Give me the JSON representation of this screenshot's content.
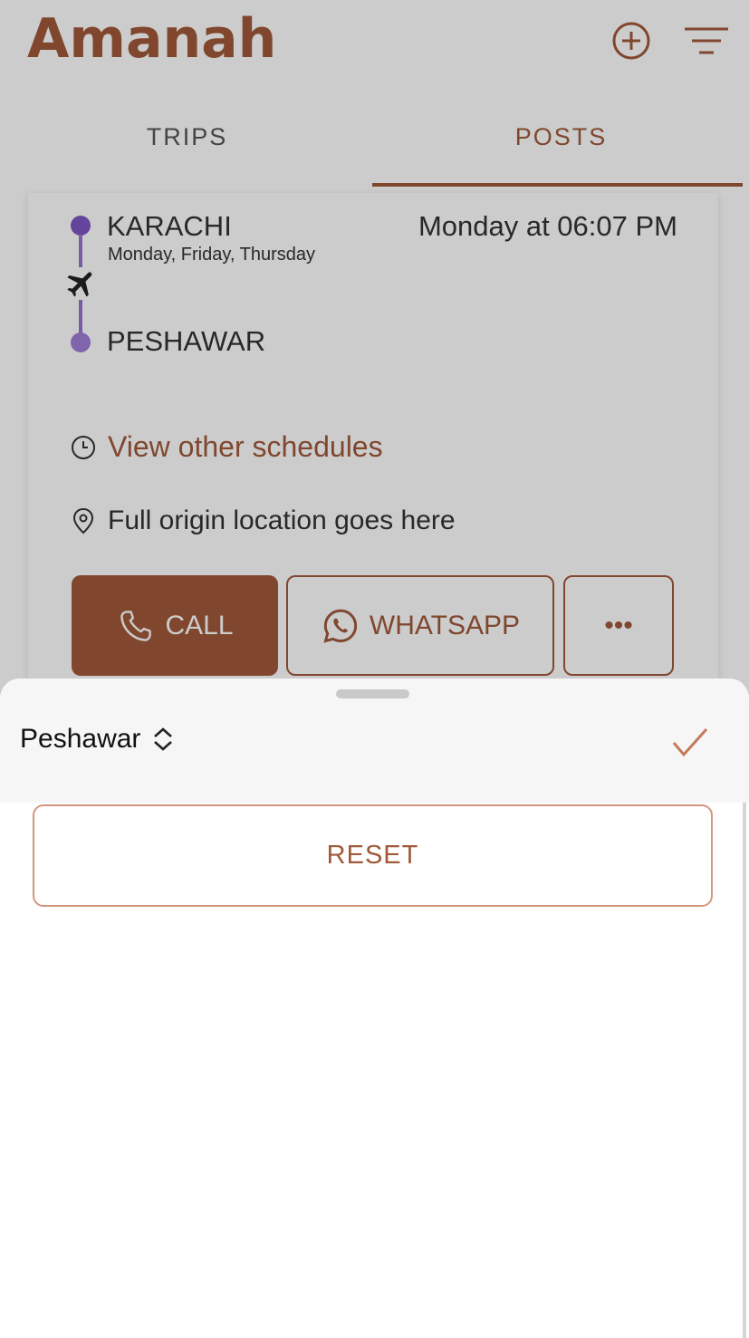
{
  "app": {
    "title": "Amanah"
  },
  "header": {
    "add_icon": "plus-circle-icon",
    "filter_icon": "filter-lines-icon"
  },
  "tabs": [
    {
      "label": "TRIPS",
      "active": false
    },
    {
      "label": "POSTS",
      "active": true
    }
  ],
  "card": {
    "origin": "KARACHI",
    "days": "Monday, Friday, Thursday",
    "time": "Monday at 06:07 PM",
    "destination": "PESHAWAR",
    "view_schedules": "View other schedules",
    "location": "Full origin location goes here",
    "call_label": "CALL",
    "whatsapp_label": "WHATSAPP",
    "more_label": "•••"
  },
  "sheet": {
    "picker_value": "Peshawar",
    "picker_icon": "chevron-up-down-icon",
    "confirm_icon": "checkmark-icon",
    "reset_label": "RESET"
  },
  "colors": {
    "accent": "#a0593a",
    "route_purple": "#7e57c2",
    "reset_border": "#d2977d"
  }
}
